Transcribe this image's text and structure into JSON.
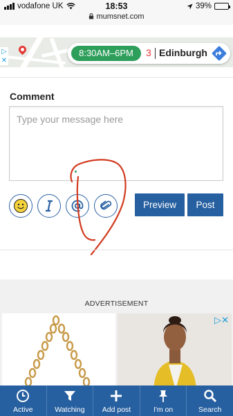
{
  "status_bar": {
    "carrier": "vodafone UK",
    "time": "18:53",
    "battery": "39%",
    "battery_level": 0.39,
    "url": "mumsnet.com"
  },
  "map_ad": {
    "hours": "8:30AM–6PM",
    "count": "3",
    "city": "Edinburgh"
  },
  "comment": {
    "label": "Comment",
    "placeholder": "Type your message here",
    "value": ""
  },
  "toolbar": {
    "emoji_icon": "smiley-icon",
    "italic_icon": "italic-icon",
    "mention_icon": "at-icon",
    "attach_icon": "paperclip-icon"
  },
  "buttons": {
    "preview": "Preview",
    "post": "Post"
  },
  "advertisement": {
    "label": "ADVERTISEMENT"
  },
  "bottom_nav": {
    "items": [
      {
        "label": "Active",
        "icon": "clock-icon"
      },
      {
        "label": "Watching",
        "icon": "filter-icon"
      },
      {
        "label": "Add post",
        "icon": "plus-icon"
      },
      {
        "label": "I'm on",
        "icon": "pin-icon"
      },
      {
        "label": "Search",
        "icon": "search-icon"
      }
    ]
  },
  "colors": {
    "primary": "#2760a0",
    "annotation": "#d23a1f",
    "map_green": "#2e9e5b"
  }
}
